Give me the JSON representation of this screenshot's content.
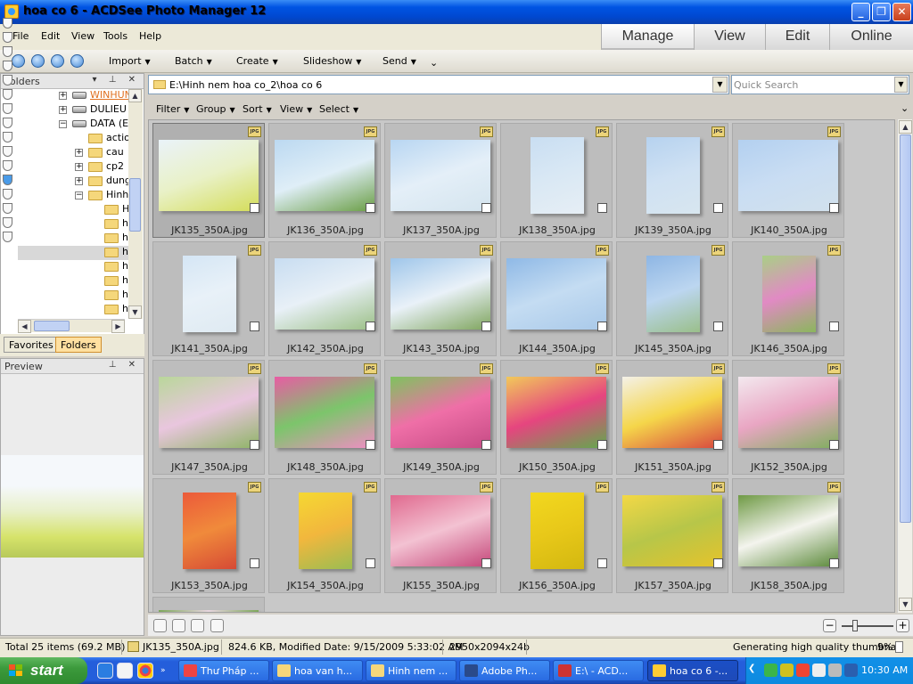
{
  "window": {
    "title": "hoa co 6 - ACDSee Photo Manager 12"
  },
  "menu": [
    "File",
    "Edit",
    "View",
    "Tools",
    "Help"
  ],
  "modes": [
    "Manage",
    "View",
    "Edit",
    "Online"
  ],
  "toolbar": {
    "items": [
      "Import",
      "Batch",
      "Create",
      "Slideshow",
      "Send"
    ]
  },
  "folders_pane": {
    "title": "Folders",
    "tree": [
      "WINHUN",
      "DULIEU",
      "DATA (E",
      "actio",
      "cau",
      "cp2",
      "dung",
      "Hinh",
      "H",
      "h",
      "h",
      "h",
      "h",
      "h",
      "h",
      "h"
    ],
    "tabs": [
      "Favorites",
      "Folders"
    ]
  },
  "preview_pane": {
    "title": "Preview"
  },
  "address": {
    "path": "E:\\Hinh nem hoa co_2\\hoa co 6",
    "search_placeholder": "Quick Search"
  },
  "filterbar": [
    "Filter",
    "Group",
    "Sort",
    "View",
    "Select"
  ],
  "file_badge": "JPG",
  "files": [
    {
      "name": "JK135_350A.jpg",
      "colors": [
        "#eaf3f9",
        "#e9f1c7",
        "#d4dd5a"
      ],
      "orient": "land"
    },
    {
      "name": "JK136_350A.jpg",
      "colors": [
        "#bcd9f1",
        "#dfeef7",
        "#6a9e45"
      ],
      "orient": "land"
    },
    {
      "name": "JK137_350A.jpg",
      "colors": [
        "#b8d6f2",
        "#e4eff8",
        "#d4e4ee"
      ],
      "orient": "land"
    },
    {
      "name": "JK138_350A.jpg",
      "colors": [
        "#c9def2",
        "#d9e8f4",
        "#e6eef5"
      ],
      "orient": "port"
    },
    {
      "name": "JK139_350A.jpg",
      "colors": [
        "#b6d2ef",
        "#cfe1f3",
        "#d8e6ef"
      ],
      "orient": "port"
    },
    {
      "name": "JK140_350A.jpg",
      "colors": [
        "#b3d0f0",
        "#c9ddf3",
        "#d2e1ec"
      ],
      "orient": "land"
    },
    {
      "name": "JK141_350A.jpg",
      "colors": [
        "#d5e6f5",
        "#e8f1f8",
        "#dfeaf2"
      ],
      "orient": "port"
    },
    {
      "name": "JK142_350A.jpg",
      "colors": [
        "#c8ddf1",
        "#e8f0f7",
        "#9cc087"
      ],
      "orient": "land"
    },
    {
      "name": "JK143_350A.jpg",
      "colors": [
        "#9fc6ea",
        "#e9f1f8",
        "#7fa55e"
      ],
      "orient": "land"
    },
    {
      "name": "JK144_350A.jpg",
      "colors": [
        "#8fb9e6",
        "#c4dcf2",
        "#a9c9e9"
      ],
      "orient": "land"
    },
    {
      "name": "JK145_350A.jpg",
      "colors": [
        "#8eb6e4",
        "#bcd6f0",
        "#9abf8a"
      ],
      "orient": "port"
    },
    {
      "name": "JK146_350A.jpg",
      "colors": [
        "#a9cf86",
        "#e18ac4",
        "#8bb65d"
      ],
      "orient": "port"
    },
    {
      "name": "JK147_350A.jpg",
      "colors": [
        "#b9d79a",
        "#e9c6de",
        "#8fb467"
      ],
      "orient": "land"
    },
    {
      "name": "JK148_350A.jpg",
      "colors": [
        "#e85ca4",
        "#7cc56b",
        "#f08ec4"
      ],
      "orient": "land"
    },
    {
      "name": "JK149_350A.jpg",
      "colors": [
        "#7ec35e",
        "#ef6fa7",
        "#c64b85"
      ],
      "orient": "land"
    },
    {
      "name": "JK150_350A.jpg",
      "colors": [
        "#f1c95a",
        "#e6457f",
        "#62a94e"
      ],
      "orient": "land"
    },
    {
      "name": "JK151_350A.jpg",
      "colors": [
        "#f4f1e8",
        "#f5d64a",
        "#d8473f"
      ],
      "orient": "land"
    },
    {
      "name": "JK152_350A.jpg",
      "colors": [
        "#f3e9ef",
        "#e9a6c3",
        "#7fae5e"
      ],
      "orient": "land"
    },
    {
      "name": "JK153_350A.jpg",
      "colors": [
        "#ec5a3a",
        "#f08a3b",
        "#d64a35"
      ],
      "orient": "port"
    },
    {
      "name": "JK154_350A.jpg",
      "colors": [
        "#f5d832",
        "#f2b73d",
        "#9bbd52"
      ],
      "orient": "port"
    },
    {
      "name": "JK155_350A.jpg",
      "colors": [
        "#e06a8f",
        "#f3c2d2",
        "#c5477a"
      ],
      "orient": "land"
    },
    {
      "name": "JK156_350A.jpg",
      "colors": [
        "#f2d81f",
        "#e8c819",
        "#d3b810"
      ],
      "orient": "port"
    },
    {
      "name": "JK157_350A.jpg",
      "colors": [
        "#f3d846",
        "#b7c649",
        "#e5c32b"
      ],
      "orient": "land"
    },
    {
      "name": "JK158_350A.jpg",
      "colors": [
        "#6f9a45",
        "#f4f4ee",
        "#5c8a3b"
      ],
      "orient": "land"
    }
  ],
  "status": {
    "total": "Total 25 items  (69.2 MB)",
    "selected": "JK135_350A.jpg",
    "info": "824.6 KB, Modified Date: 9/15/2009 5:33:02 AM",
    "dims": "2950x2094x24b",
    "task": "Generating high quality thumbnail",
    "percent": "9%"
  },
  "taskbar": {
    "start": "start",
    "tasks": [
      "Thư Pháp ...",
      "hoa van h...",
      "Hinh nem ...",
      "Adobe Ph...",
      "E:\\ - ACD...",
      "hoa co 6 -..."
    ],
    "clock": "10:30 AM"
  }
}
